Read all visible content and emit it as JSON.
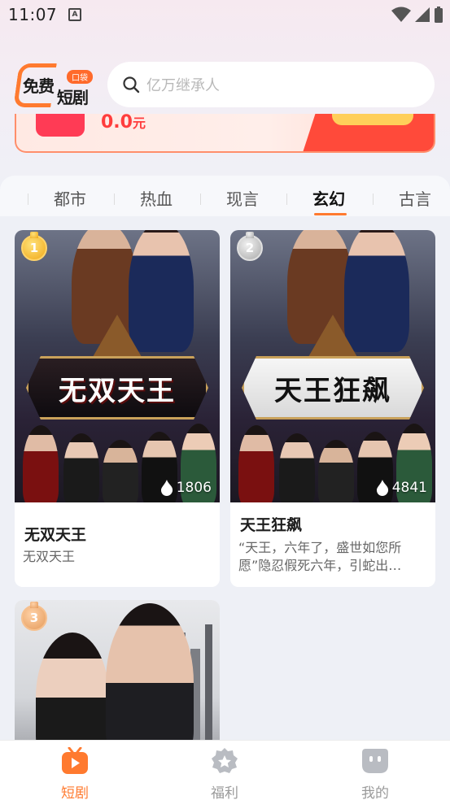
{
  "status_bar": {
    "time": "11:07",
    "notification_icon": "A"
  },
  "header": {
    "logo": {
      "text_main": "免费",
      "text_sub": "短剧",
      "badge": "口袋"
    },
    "search": {
      "placeholder": "亿万继承人"
    }
  },
  "banner": {
    "amount": "0.0",
    "unit": "元"
  },
  "tabs": [
    {
      "label": "都市",
      "active": false
    },
    {
      "label": "热血",
      "active": false
    },
    {
      "label": "现言",
      "active": false
    },
    {
      "label": "玄幻",
      "active": true
    },
    {
      "label": "古言",
      "active": false
    }
  ],
  "cards": [
    {
      "rank": "1",
      "poster_title": "无双天王",
      "plays": "1806",
      "title": "无双天王",
      "description": "无双天王"
    },
    {
      "rank": "2",
      "poster_title": "天王狂飙",
      "plays": "4841",
      "title": "天王狂飙",
      "description": "“天王，六年了，盛世如您所愿”隐忍假死六年，引蛇出…"
    },
    {
      "rank": "3"
    }
  ],
  "bottom_nav": [
    {
      "label": "短剧",
      "icon": "drama-tv-icon",
      "active": true
    },
    {
      "label": "福利",
      "icon": "welfare-star-icon",
      "active": false
    },
    {
      "label": "我的",
      "icon": "profile-face-icon",
      "active": false
    }
  ],
  "colors": {
    "accent": "#ff7a2f",
    "banner_red": "#ff3d3d"
  }
}
